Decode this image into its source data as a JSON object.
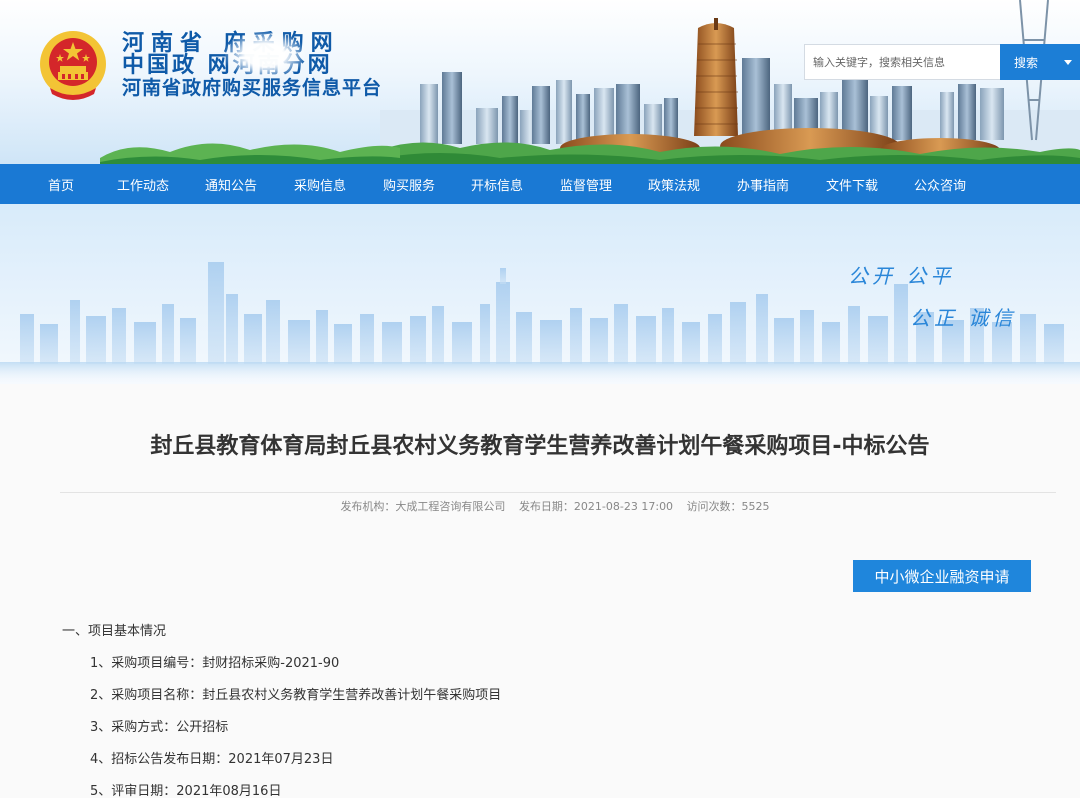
{
  "header": {
    "logo_line1": "河南省    府采购网",
    "logo_line2": "中国政    网河南分网",
    "logo_line3": "河南省政府购买服务信息平台",
    "search": {
      "placeholder": "输入关键字，搜索相关信息",
      "button_label": "搜索"
    }
  },
  "nav": {
    "items": [
      {
        "label": "首页"
      },
      {
        "label": "工作动态"
      },
      {
        "label": "通知公告"
      },
      {
        "label": "采购信息"
      },
      {
        "label": "购买服务"
      },
      {
        "label": "开标信息"
      },
      {
        "label": "监督管理"
      },
      {
        "label": "政策法规"
      },
      {
        "label": "办事指南"
      },
      {
        "label": "文件下载"
      },
      {
        "label": "公众咨询"
      }
    ]
  },
  "banner": {
    "slogan_line1": "公开  公平",
    "slogan_line2": "公正  诚信"
  },
  "article": {
    "title": "封丘县教育体育局封丘县农村义务教育学生营养改善计划午餐采购项目-中标公告",
    "meta": {
      "publisher": "发布机构：大成工程咨询有限公司",
      "date": "发布日期：2021-08-23 17:00",
      "visits": "访问次数：5525"
    },
    "finance_button": "中小微企业融资申请",
    "section_heading": "一、项目基本情况",
    "items": [
      "1、采购项目编号：封财招标采购-2021-90",
      "2、采购项目名称：封丘县农村义务教育学生营养改善计划午餐采购项目",
      "3、采购方式：公开招标",
      "4、招标公告发布日期：2021年07月23日",
      "5、评审日期：2021年08月16日"
    ]
  },
  "colors": {
    "nav_bg": "#1a79d4",
    "brand_blue": "#0f5aa8",
    "button_blue": "#1f86dc",
    "emblem_red": "#d4262a",
    "emblem_gold": "#f3c435"
  },
  "icons": {
    "emblem": "national-emblem-icon",
    "dropdown": "chevron-down-icon"
  }
}
